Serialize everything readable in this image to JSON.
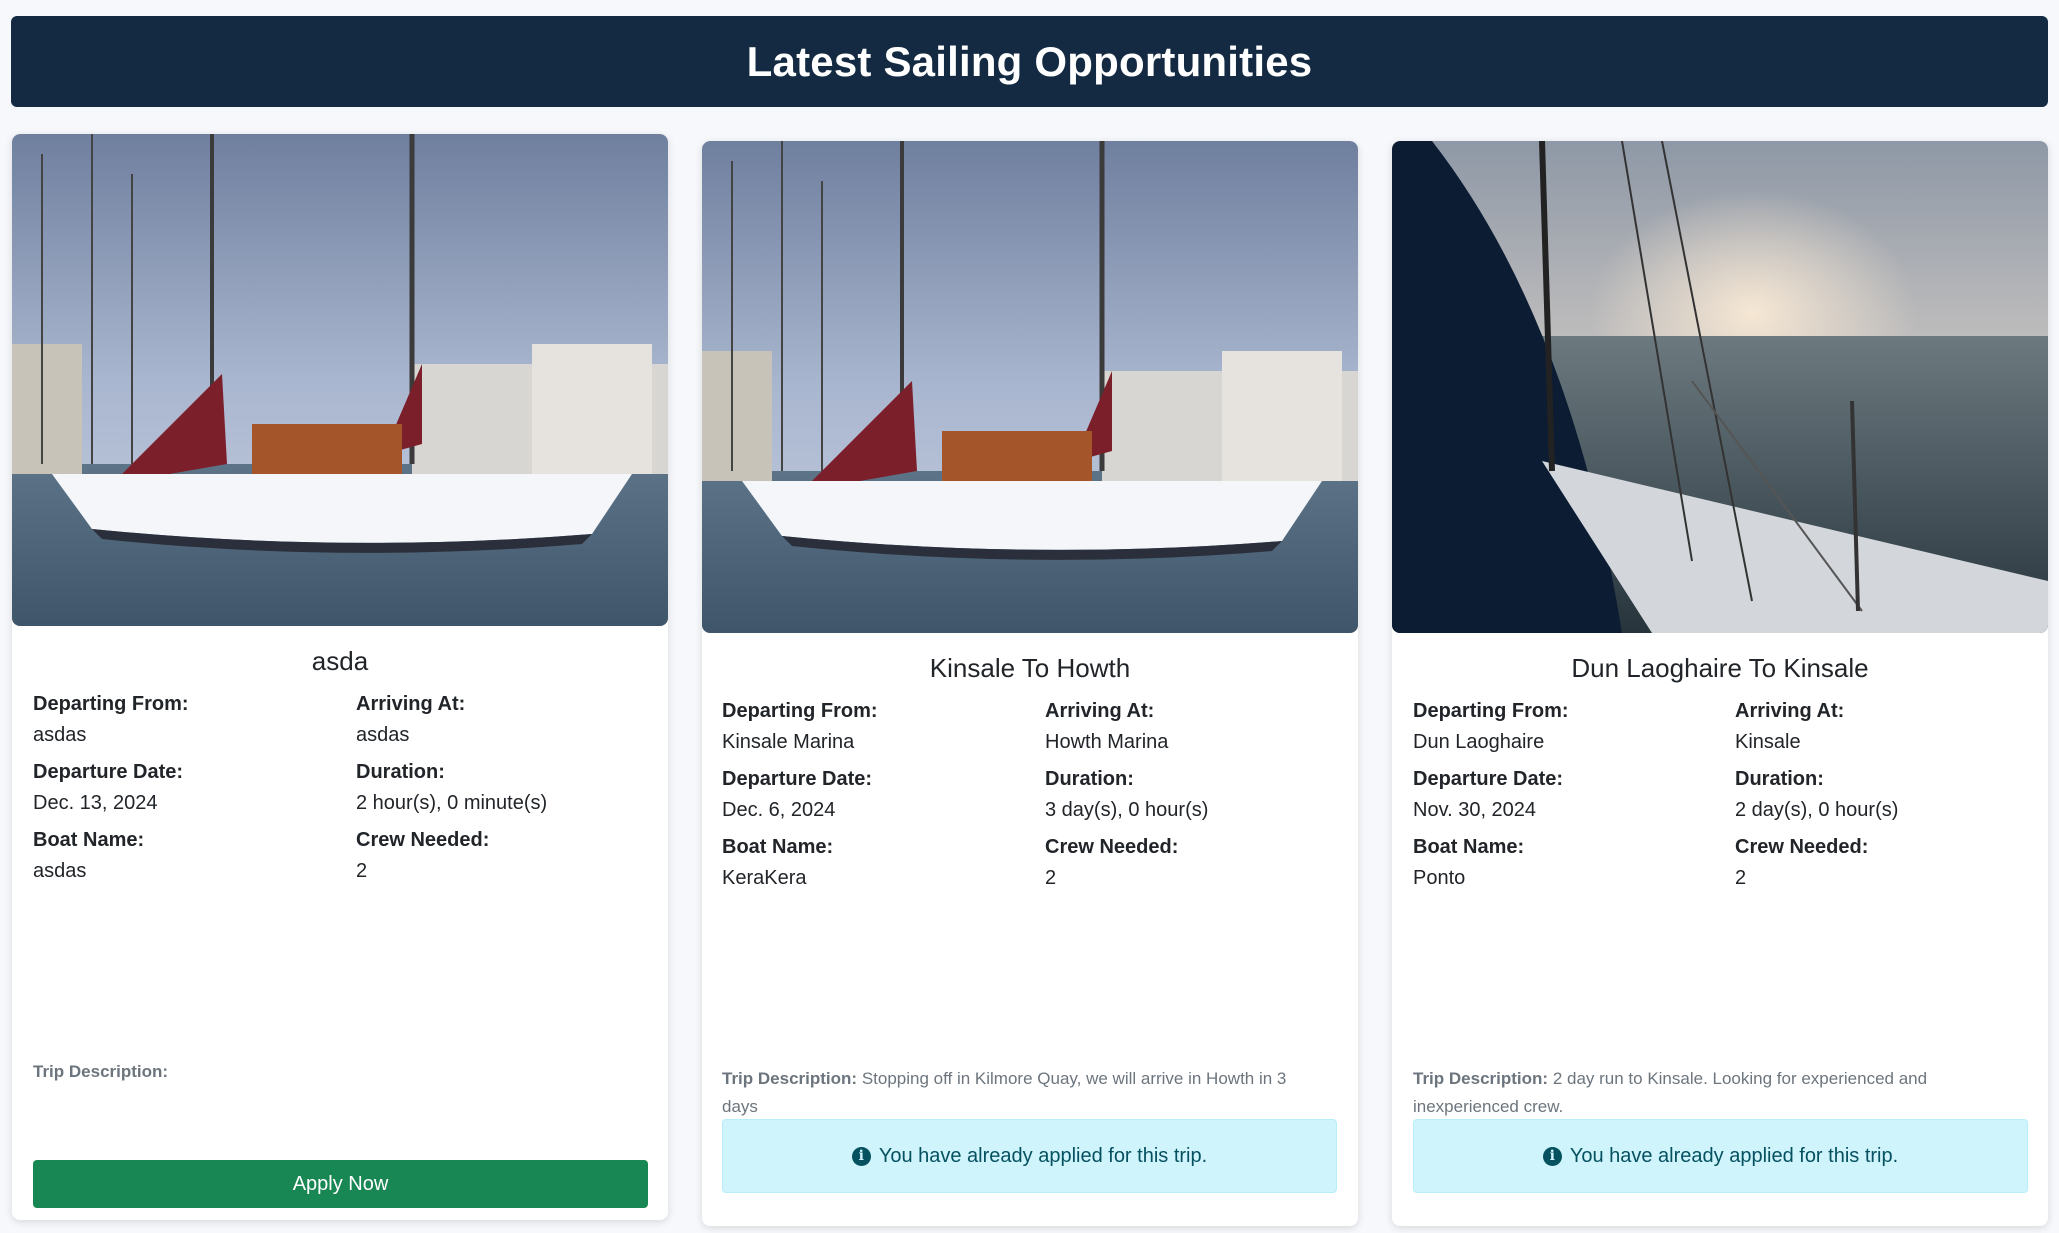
{
  "page": {
    "title": "Latest Sailing Opportunities"
  },
  "labels": {
    "departing_from": "Departing From:",
    "arriving_at": "Arriving At:",
    "departure_date": "Departure Date:",
    "duration": "Duration:",
    "boat_name": "Boat Name:",
    "crew_needed": "Crew Needed:",
    "trip_description": "Trip Description:"
  },
  "trips": [
    {
      "title": "asda",
      "departing_from": "asdas",
      "arriving_at": "asdas",
      "departure_date": "Dec. 13, 2024",
      "duration": "2 hour(s), 0 minute(s)",
      "boat_name": "asdas",
      "crew_needed": "2",
      "description": "",
      "action": "Apply Now",
      "image": "sailboat-marina-photo"
    },
    {
      "title": "Kinsale To Howth",
      "departing_from": "Kinsale Marina",
      "arriving_at": "Howth Marina",
      "departure_date": "Dec. 6, 2024",
      "duration": "3 day(s), 0 hour(s)",
      "boat_name": "KeraKera",
      "crew_needed": "2",
      "description": "Stopping off in Kilmore Quay, we will arrive in Howth in 3 days",
      "status": "You have already applied for this trip.",
      "image": "sailboat-marina-photo"
    },
    {
      "title": "Dun Laoghaire To Kinsale",
      "departing_from": "Dun Laoghaire",
      "arriving_at": "Kinsale",
      "departure_date": "Nov. 30, 2024",
      "duration": "2 day(s), 0 hour(s)",
      "boat_name": "Ponto",
      "crew_needed": "2",
      "description": "2 day run to Kinsale. Looking for experienced and inexperienced crew.",
      "status": "You have already applied for this trip.",
      "image": "sailboat-bow-sea-photo"
    }
  ],
  "colors": {
    "header_bg": "#132a42",
    "apply_button": "#198754",
    "alert_bg": "#cff4fc",
    "alert_text": "#055160"
  }
}
